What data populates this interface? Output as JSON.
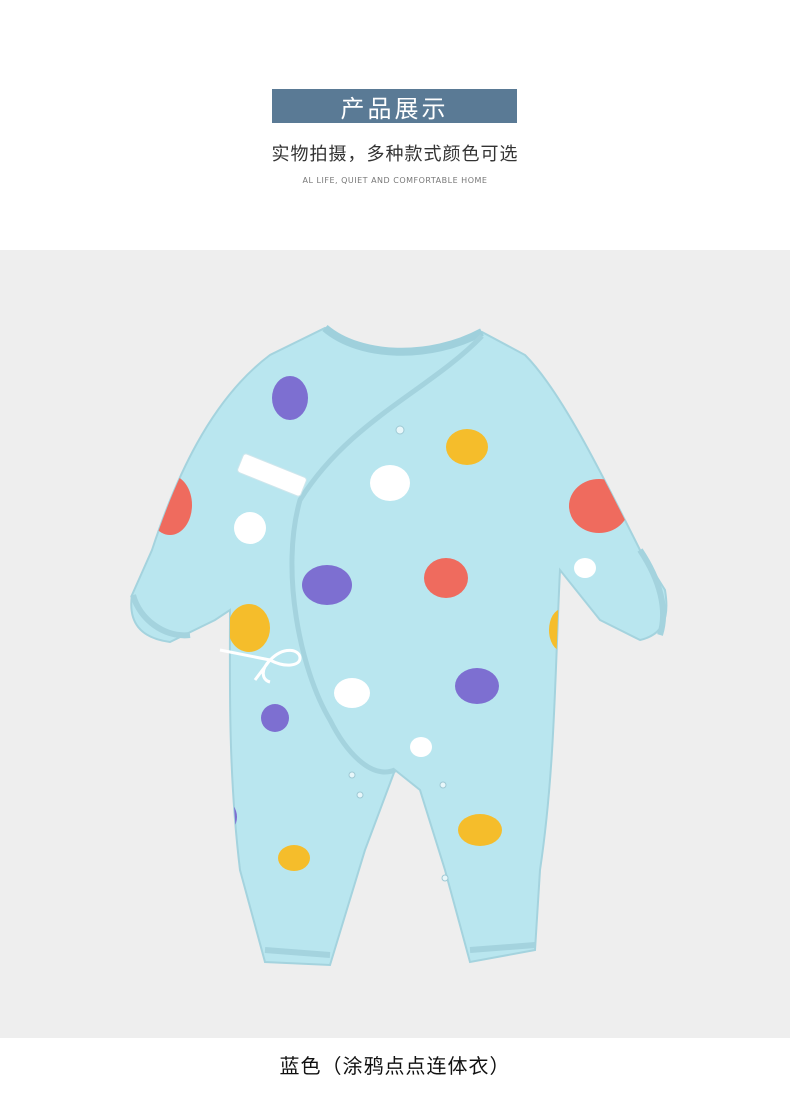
{
  "header": {
    "title": "产品展示",
    "subtitle": "实物拍摄，多种款式颜色可选",
    "caption_en": "AL LIFE, QUIET AND COMFORTABLE HOME"
  },
  "product": {
    "image_subject": "romper-icon",
    "label": "蓝色（涂鸦点点连体衣）"
  },
  "colors": {
    "banner_bg": "#5a7a95",
    "photo_bg": "#eeeeee",
    "garment": "#b9e6ef",
    "dot_purple": "#7d6fd1",
    "dot_yellow": "#f5bd2b",
    "dot_red": "#ef6b5e",
    "dot_white": "#ffffff"
  }
}
